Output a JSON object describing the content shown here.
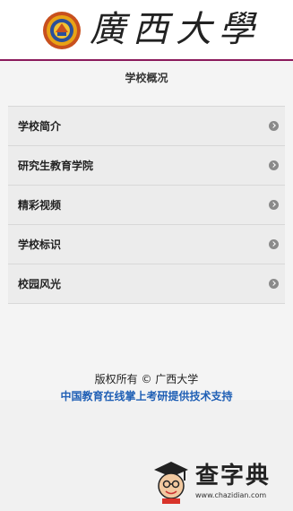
{
  "header": {
    "logo_text": "廣西大學"
  },
  "page_title": "学校概况",
  "menu": {
    "items": [
      {
        "label": "学校简介"
      },
      {
        "label": "研究生教育学院"
      },
      {
        "label": "精彩视频"
      },
      {
        "label": "学校标识"
      },
      {
        "label": "校园风光"
      }
    ]
  },
  "footer": {
    "copyright": "版权所有 © 广西大学",
    "support": "中国教育在线掌上考研提供技术支持"
  },
  "watermark": {
    "title": "查字典",
    "url": "www.chazidian.com"
  },
  "colors": {
    "header_border": "#8b1a5c",
    "link": "#1f5fb5",
    "chevron": "#8a8a8a"
  }
}
